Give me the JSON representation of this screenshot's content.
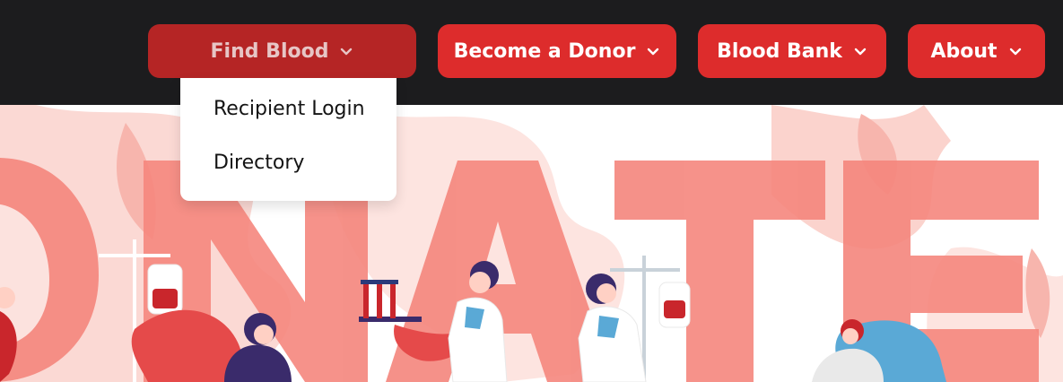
{
  "colors": {
    "topbar": "#1c1c1e",
    "nav_button": "#dd2c2c",
    "nav_button_active": "#b52525",
    "hero_letters": "#f5867d"
  },
  "nav": {
    "items": [
      {
        "label": "Find Blood",
        "icon": "chevron-down-icon",
        "active": true
      },
      {
        "label": "Become a Donor",
        "icon": "chevron-down-icon"
      },
      {
        "label": "Blood Bank",
        "icon": "chevron-down-icon"
      },
      {
        "label": "About",
        "icon": "chevron-down-icon"
      }
    ]
  },
  "dropdown": {
    "items": [
      {
        "label": "Recipient Login"
      },
      {
        "label": "Directory"
      }
    ]
  },
  "hero": {
    "illustration_text": "DONATE"
  }
}
